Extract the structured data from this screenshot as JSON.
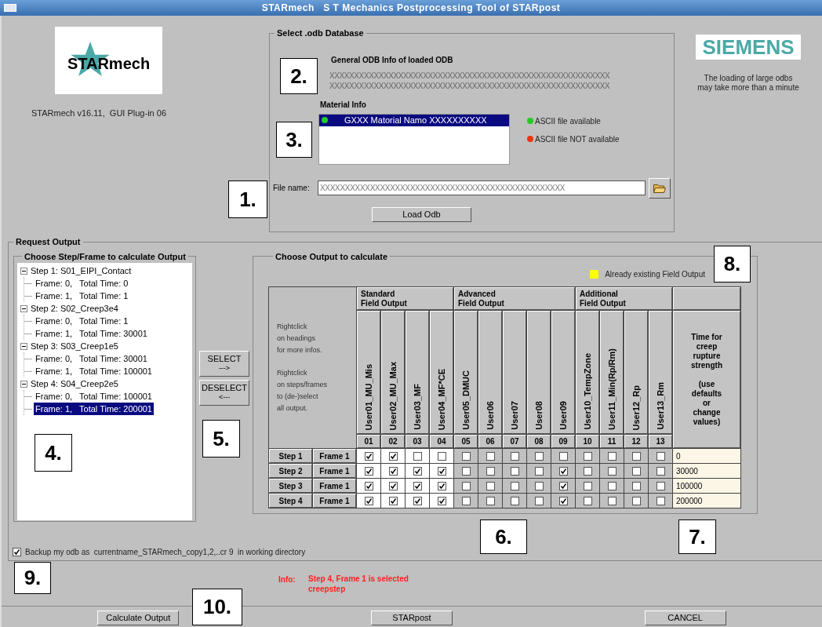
{
  "window": {
    "title": "STARmech   S T Mechanics Postprocessing Tool of STARpost"
  },
  "logo": {
    "text": "STARmech"
  },
  "version": "STARmech v16.11,  GUI Plug-in 06",
  "odb_group": {
    "title": "Select .odb Database",
    "general_info_title": "General ODB Info of loaded ODB",
    "general_info_lines": [
      "XXXXXXXXXXXXXXXXXXXXXXXXXXXXXXXXXXXXXXXXXXXXXXXXXXXXXXXXX",
      "XXXXXXXXXXXXXXXXXXXXXXXXXXXXXXXXXXXXXXXXXXXXXXXXXXXXXXXXX"
    ],
    "material_title": "Material Info",
    "materials": [
      {
        "name": "GXXX Matorial Namo XXXXXXXXXX",
        "selected": true,
        "color": "#22cc22"
      }
    ],
    "legend": [
      {
        "label": "ASCII file available",
        "color": "#22cc22"
      },
      {
        "label": "ASCII file NOT available",
        "color": "#ee3311"
      }
    ],
    "file_label": "File name:",
    "file_value": "XXXXXXXXXXXXXXXXXXXXXXXXXXXXXXXXXXXXXXXXXXXXXXXXX",
    "load_button": "Load Odb"
  },
  "siemens": {
    "logo": "SIEMENS",
    "note_lines": [
      "The loading of large odbs",
      "may take more than a minute"
    ]
  },
  "request_output": {
    "title": "Request Output",
    "step_group": {
      "title": "Choose Step/Frame to calculate Output",
      "tree": [
        {
          "label": "Step 1: S01_EIPI_Contact",
          "expanded": true,
          "children": [
            {
              "label": "Frame: 0,   Total Time: 0",
              "selected": false
            },
            {
              "label": "Frame: 1,   Total Time: 1",
              "selected": false
            }
          ]
        },
        {
          "label": "Step 2: S02_Creep3e4",
          "expanded": true,
          "children": [
            {
              "label": "Frame: 0,   Total Time: 1",
              "selected": false
            },
            {
              "label": "Frame: 1,   Total Time: 30001",
              "selected": false
            }
          ]
        },
        {
          "label": "Step 3: S03_Creep1e5",
          "expanded": true,
          "children": [
            {
              "label": "Frame: 0,   Total Time: 30001",
              "selected": false
            },
            {
              "label": "Frame: 1,   Total Time: 100001",
              "selected": false
            }
          ]
        },
        {
          "label": "Step 4: S04_Creep2e5",
          "expanded": true,
          "children": [
            {
              "label": "Frame: 0,   Total Time: 100001",
              "selected": false
            },
            {
              "label": "Frame: 1,   Total Time: 200001",
              "selected": true
            }
          ]
        }
      ]
    },
    "select_button": {
      "label": "SELECT",
      "arrow": "--->"
    },
    "deselect_button": {
      "label": "DESELECT",
      "arrow": "<---"
    },
    "output_group": {
      "title": "Choose Output to calculate",
      "legend": {
        "label": "Already existing Field Output",
        "color": "#ffff00"
      },
      "hint_paragraphs": [
        [
          "Rightclick",
          "on headings",
          "for more infos."
        ],
        [
          "Rightclick",
          "on steps/frames",
          "to (de-)select",
          "all output."
        ]
      ],
      "groups": [
        {
          "lines": [
            "Standard",
            "Field Output"
          ],
          "columns": [
            {
              "name": "User01_MU_Mis",
              "number": "01",
              "enabled": true
            },
            {
              "name": "User02_MU_Max",
              "number": "02",
              "enabled": true
            },
            {
              "name": "User03_MF",
              "number": "03",
              "enabled": true
            },
            {
              "name": "User04_MF*CE",
              "number": "04",
              "enabled": true
            }
          ]
        },
        {
          "lines": [
            "Advanced",
            "Field Output"
          ],
          "columns": [
            {
              "name": "User05_DMUC",
              "number": "05",
              "enabled": false
            },
            {
              "name": "User06",
              "number": "06",
              "enabled": false
            },
            {
              "name": "User07",
              "number": "07",
              "enabled": false
            },
            {
              "name": "User08",
              "number": "08",
              "enabled": false
            },
            {
              "name": "User09",
              "number": "09",
              "enabled": false
            }
          ]
        },
        {
          "lines": [
            "Additional",
            "Field Output"
          ],
          "columns": [
            {
              "name": "User10_TempZone",
              "number": "10",
              "enabled": false
            },
            {
              "name": "User11_Min(Rp/Rm)",
              "number": "11",
              "enabled": false
            },
            {
              "name": "User12_Rp",
              "number": "12",
              "enabled": false
            },
            {
              "name": "User13_Rm",
              "number": "13",
              "enabled": false
            }
          ]
        }
      ],
      "time_header_paragraphs": [
        [
          "Time for",
          "creep",
          "rupture",
          "strength"
        ],
        [
          "(use",
          "defaults",
          "or",
          "change",
          "values)"
        ]
      ],
      "rows": [
        {
          "step": "Step 1",
          "frame": "Frame 1",
          "checks": [
            true,
            true,
            false,
            false,
            false,
            false,
            false,
            false,
            false,
            false,
            false,
            false,
            false
          ],
          "time": "0"
        },
        {
          "step": "Step 2",
          "frame": "Frame 1",
          "checks": [
            true,
            true,
            true,
            true,
            false,
            false,
            false,
            false,
            true,
            false,
            false,
            false,
            false
          ],
          "time": "30000"
        },
        {
          "step": "Step 3",
          "frame": "Frame 1",
          "checks": [
            true,
            true,
            true,
            true,
            false,
            false,
            false,
            false,
            true,
            false,
            false,
            false,
            false
          ],
          "time": "100000"
        },
        {
          "step": "Step 4",
          "frame": "Frame 1",
          "checks": [
            true,
            true,
            true,
            true,
            false,
            false,
            false,
            false,
            true,
            false,
            false,
            false,
            false
          ],
          "time": "200000"
        }
      ]
    },
    "backup": {
      "checked": true,
      "label": "Backup my odb as  currentname_STARmech_copy1,2,..cr 9  in working directory"
    }
  },
  "info": {
    "label": "Info:",
    "lines": [
      "Step 4, Frame 1 is selected",
      "creepstep"
    ]
  },
  "buttons": [
    "Calculate Output",
    "STARpost",
    "CANCEL"
  ],
  "callouts": [
    "1.",
    "2.",
    "3.",
    "4.",
    "5.",
    "6.",
    "7.",
    "8.",
    "9.",
    "10."
  ]
}
